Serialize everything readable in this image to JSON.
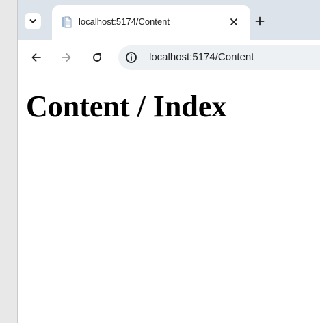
{
  "browser": {
    "tab": {
      "title": "localhost:5174/Content",
      "favicon": "document-icon",
      "close_icon": "close-icon"
    },
    "tab_search_icon": "chevron-down-icon",
    "new_tab_icon": "plus-icon",
    "toolbar": {
      "back_icon": "arrow-left-icon",
      "forward_icon": "arrow-right-icon",
      "reload_icon": "reload-icon",
      "site_info_icon": "info-icon",
      "url": "localhost:5174/Content"
    }
  },
  "page": {
    "heading": "Content / Index"
  },
  "colors": {
    "tabstrip_bg": "#dde3ea",
    "omnibox_bg": "#eef1f4",
    "outer_bg": "#e8e8e8"
  }
}
